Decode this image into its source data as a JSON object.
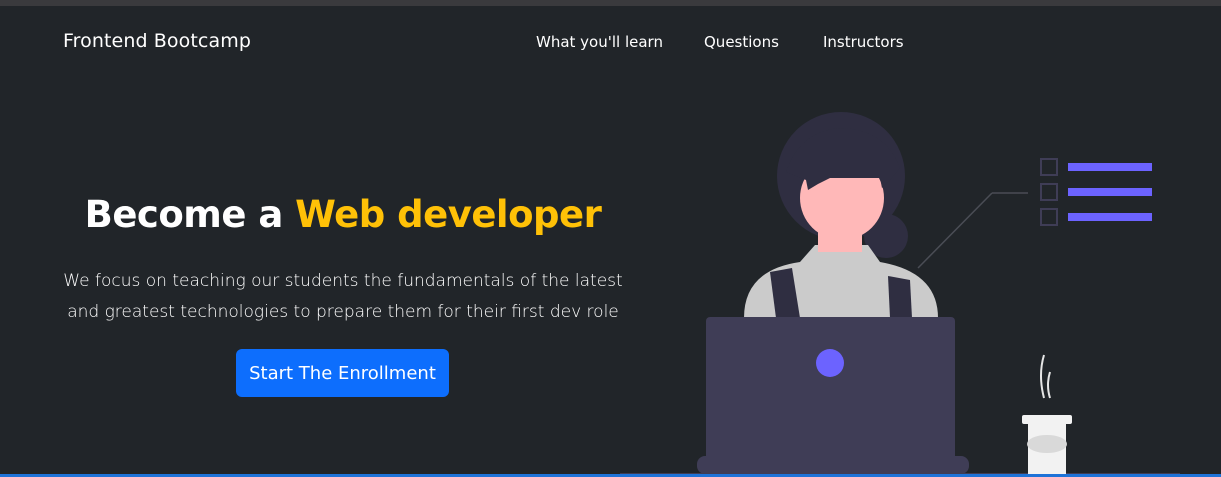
{
  "navbar": {
    "brand": "Frontend Bootcamp",
    "links": [
      {
        "label": "What you'll learn"
      },
      {
        "label": "Questions"
      },
      {
        "label": "Instructors"
      }
    ]
  },
  "hero": {
    "title_prefix": "Become a ",
    "title_accent": "Web developer",
    "description": "We focus on teaching our students the fundamentals of the latest and greatest technologies to prepare them for their first dev role",
    "cta_label": "Start The Enrollment"
  },
  "colors": {
    "background": "#212529",
    "accent": "#ffc107",
    "primary_button": "#0d6efd",
    "illustration_purple": "#6c63ff",
    "laptop": "#3f3d56"
  },
  "icons": [
    "person-illustration",
    "laptop-illustration",
    "checklist-illustration",
    "coffee-cup-illustration"
  ]
}
